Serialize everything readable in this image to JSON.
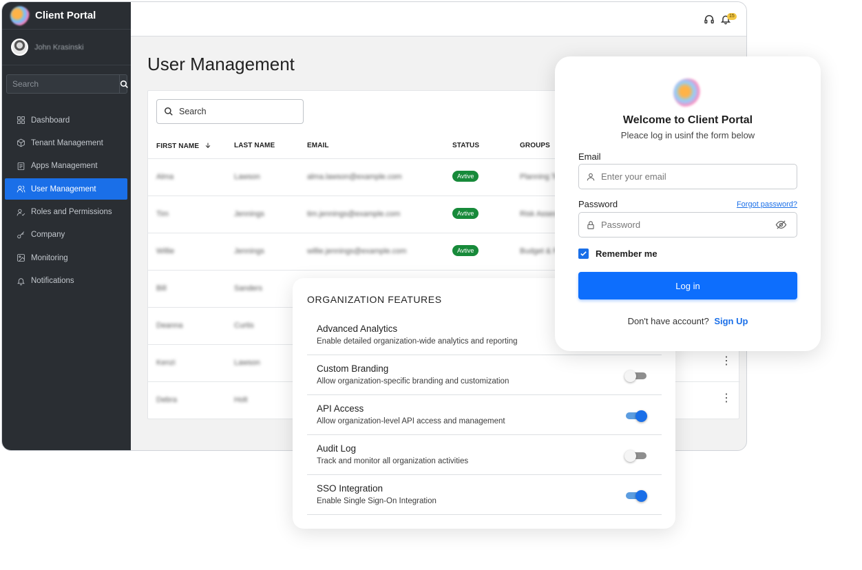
{
  "app": {
    "brand_title": "Client Portal",
    "user_name": "John Krasinski",
    "notification_count": "15"
  },
  "sidebar": {
    "search_placeholder": "Search",
    "items": [
      {
        "label": "Dashboard",
        "icon": "grid-icon"
      },
      {
        "label": "Tenant Management",
        "icon": "cube-icon"
      },
      {
        "label": "Apps Management",
        "icon": "document-icon"
      },
      {
        "label": "User Management",
        "icon": "users-icon",
        "active": true
      },
      {
        "label": "Roles and Permissions",
        "icon": "user-check-icon"
      },
      {
        "label": "Company",
        "icon": "key-icon"
      },
      {
        "label": "Monitoring",
        "icon": "image-icon"
      },
      {
        "label": "Notifications",
        "icon": "bell-icon"
      }
    ]
  },
  "main": {
    "page_title": "User Management",
    "search_placeholder": "Search",
    "columns": [
      "FIRST NAME",
      "LAST NAME",
      "EMAIL",
      "STATUS",
      "GROUPS"
    ],
    "rows": [
      {
        "first": "Alma",
        "last": "Lawson",
        "email": "alma.lawson@example.com",
        "status": "Avtive",
        "groups": "Planning Te"
      },
      {
        "first": "Tim",
        "last": "Jennings",
        "email": "tim.jennings@example.com",
        "status": "Avtive",
        "groups": "Risk Asses"
      },
      {
        "first": "Willie",
        "last": "Jennings",
        "email": "willie.jennings@example.com",
        "status": "Avtive",
        "groups": "Budget & Fi"
      },
      {
        "first": "Bill",
        "last": "Sanders",
        "email": "",
        "status": "",
        "groups": ""
      },
      {
        "first": "Deanna",
        "last": "Curtis",
        "email": "",
        "status": "",
        "groups": ""
      },
      {
        "first": "Kenzi",
        "last": "Lawson",
        "email": "",
        "status": "",
        "groups": ""
      },
      {
        "first": "Debra",
        "last": "Holt",
        "email": "",
        "status": "",
        "groups": ""
      }
    ]
  },
  "org_features": {
    "title": "ORGANIZATION FEATURES",
    "features": [
      {
        "title": "Advanced Analytics",
        "description": "Enable detailed organization-wide analytics and reporting",
        "enabled": null
      },
      {
        "title": "Custom Branding",
        "description": "Allow organization-specific branding and customization",
        "enabled": false
      },
      {
        "title": "API Access",
        "description": "Allow organization-level API access and management",
        "enabled": true
      },
      {
        "title": "Audit Log",
        "description": "Track and monitor all organization activities",
        "enabled": false
      },
      {
        "title": "SSO Integration",
        "description": "Enable Single Sign-On Integration",
        "enabled": true
      }
    ]
  },
  "login": {
    "title": "Welcome to Client Portal",
    "subtitle": "Pleace log in usinf the form below",
    "email_label": "Email",
    "email_placeholder": "Enter your email",
    "password_label": "Password",
    "password_placeholder": "Password",
    "forgot_label": "Forgot password?",
    "remember_label": "Remember me",
    "remember_checked": true,
    "login_label": "Log in",
    "signup_prompt": "Don't have account?",
    "signup_label": "Sign Up"
  },
  "colors": {
    "accent": "#1a6fe8",
    "sidebar_bg": "#2a2e33",
    "status_green": "#178a3a"
  }
}
